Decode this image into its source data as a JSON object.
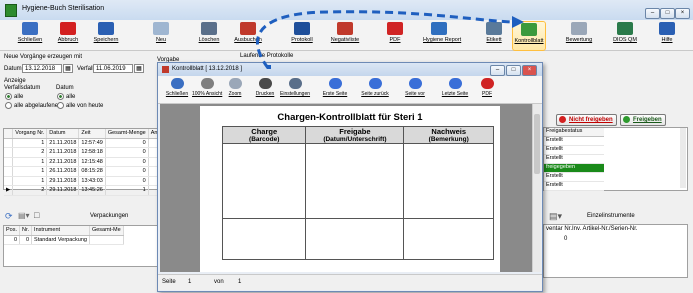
{
  "app": {
    "title": "Hygiene-Buch Sterilisation"
  },
  "toolbar": [
    {
      "label": "Schließen",
      "color": "#3b6fc2"
    },
    {
      "label": "Abbruch",
      "color": "#d32020"
    },
    {
      "label": "Speichern",
      "color": "#2a5fb3"
    },
    {
      "label": "Neu",
      "color": "#9fb6d1"
    },
    {
      "label": "Löschen",
      "color": "#5a6f8a"
    },
    {
      "label": "Ausbuchen",
      "color": "#c0392b"
    },
    {
      "label": "Protokoll",
      "color": "#1f4f9a"
    },
    {
      "label": "Negativliste",
      "color": "#c0392b"
    },
    {
      "label": "PDF",
      "color": "#d02424"
    },
    {
      "label": "Hygiene Report",
      "color": "#2f6fbf"
    },
    {
      "label": "Etikett",
      "color": "#5a7a9a"
    },
    {
      "label": "Kontrollblatt",
      "color": "#3c9a3c"
    },
    {
      "label": "Bewertung",
      "color": "#9aa7b8"
    },
    {
      "label": "DIOS QM",
      "color": "#2a7a4a"
    },
    {
      "label": "Hilfe",
      "color": "#2a5fb3"
    }
  ],
  "left": {
    "section_title": "Neue Vorgänge erzeugen mit",
    "datum_label": "Datum",
    "datum_value": "13.12.2018",
    "verfall_label": "Verfall",
    "verfall_value": "11.06.2019",
    "anzeige_label": "Anzeige",
    "verfallsdatum_label": "Verfallsdatum",
    "datum2_label": "Datum",
    "radio_alle": "alle",
    "radio_alle2": "alle",
    "radio_abgelaufen": "alle abgelaufenen",
    "radio_heute": "alle von heute",
    "grid_headers": [
      "Vorgang Nr.",
      "Datum",
      "Zeit",
      "Gesamt-Menge",
      "An"
    ],
    "grid_rows": [
      [
        "1",
        "21.11.2018",
        "12:57:49",
        "0"
      ],
      [
        "2",
        "21.11.2018",
        "12:58:18",
        "0"
      ],
      [
        "1",
        "22.11.2018",
        "12:15:48",
        "0"
      ],
      [
        "1",
        "26.11.2018",
        "08:15:28",
        "0"
      ],
      [
        "1",
        "29.11.2018",
        "13:43:03",
        "0"
      ],
      [
        "2",
        "29.11.2018",
        "13:45:26",
        "1"
      ]
    ],
    "verpackungen_label": "Verpackungen",
    "verp_headers": [
      "Pos.",
      "Nr.",
      "Instrument",
      "Gesamt-Me"
    ],
    "verp_row": [
      "0",
      "0",
      "Standard Verpackung"
    ]
  },
  "middle": {
    "vorgabe_label": "Vorgabe",
    "laufende_label": "Laufende Protokolle"
  },
  "right": {
    "nicht_freigeben": "Nicht freigeben",
    "freigeben": "Freigeben",
    "status_header": "Freigabestatus",
    "status_rows": [
      "Erstellt",
      "Erstellt",
      "Erstellt",
      "freigegeben",
      "Erstellt",
      "Erstellt"
    ],
    "einzel_label": "Einzelinstrumente",
    "einzel_headers": [
      "ventar Nr.",
      "Inv. Artikel-Nr./Serien-Nr."
    ],
    "einzel_row": "0"
  },
  "dialog": {
    "title": "Kontrollblatt [ 13.12.2018 ]",
    "toolbar": [
      {
        "label": "Schließen",
        "color": "#3b6fc2"
      },
      {
        "label": "100% Ansicht",
        "color": "#7f7f7f"
      },
      {
        "label": "Zoom",
        "color": "#9aa7b8"
      },
      {
        "label": "Drucken",
        "color": "#4a4a4a"
      },
      {
        "label": "Einstellungen",
        "color": "#5a6f8a"
      },
      {
        "label": "Erste Seite",
        "color": "#3a6fd8"
      },
      {
        "label": "Seite zurück",
        "color": "#3a6fd8"
      },
      {
        "label": "Seite vor",
        "color": "#3a6fd8"
      },
      {
        "label": "Letzte Seite",
        "color": "#3a6fd8"
      },
      {
        "label": "PDF",
        "color": "#d02424"
      }
    ],
    "report_title": "Chargen-Kontrollblatt für Steri 1",
    "columns": [
      {
        "title": "Charge",
        "sub": "(Barcode)"
      },
      {
        "title": "Freigabe",
        "sub": "(Datum/Unterschrift)"
      },
      {
        "title": "Nachweis",
        "sub": "(Bemerkung)"
      }
    ],
    "status": {
      "seite_label": "Seite",
      "seite_value": "1",
      "von_label": "von",
      "von_value": "1"
    }
  }
}
